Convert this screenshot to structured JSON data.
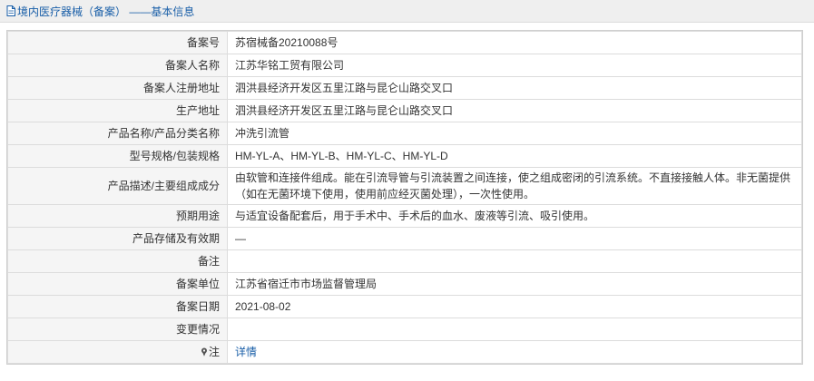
{
  "header": {
    "title": "境内医疗器械（备案）",
    "subtitle": "——基本信息",
    "doc_icon": "document-icon"
  },
  "rows": [
    {
      "label": "备案号",
      "value": "苏宿械备20210088号"
    },
    {
      "label": "备案人名称",
      "value": "江苏华铭工贸有限公司"
    },
    {
      "label": "备案人注册地址",
      "value": "泗洪县经济开发区五里江路与昆仑山路交叉口"
    },
    {
      "label": "生产地址",
      "value": "泗洪县经济开发区五里江路与昆仑山路交叉口"
    },
    {
      "label": "产品名称/产品分类名称",
      "value": "冲洗引流管"
    },
    {
      "label": "型号规格/包装规格",
      "value": "HM-YL-A、HM-YL-B、HM-YL-C、HM-YL-D"
    },
    {
      "label": "产品描述/主要组成成分",
      "value": "由软管和连接件组成。能在引流导管与引流装置之间连接，使之组成密闭的引流系统。不直接接触人体。非无菌提供（如在无菌环境下使用，使用前应经灭菌处理），一次性使用。"
    },
    {
      "label": "预期用途",
      "value": "与适宜设备配套后，用于手术中、手术后的血水、废液等引流、吸引使用。"
    },
    {
      "label": "产品存储及有效期",
      "value": "—"
    },
    {
      "label": "备注",
      "value": ""
    },
    {
      "label": "备案单位",
      "value": "江苏省宿迁市市场监督管理局"
    },
    {
      "label": "备案日期",
      "value": "2021-08-02"
    },
    {
      "label": "变更情况",
      "value": ""
    }
  ],
  "note": {
    "label": "注",
    "icon": "pin-icon",
    "link_text": "详情"
  }
}
